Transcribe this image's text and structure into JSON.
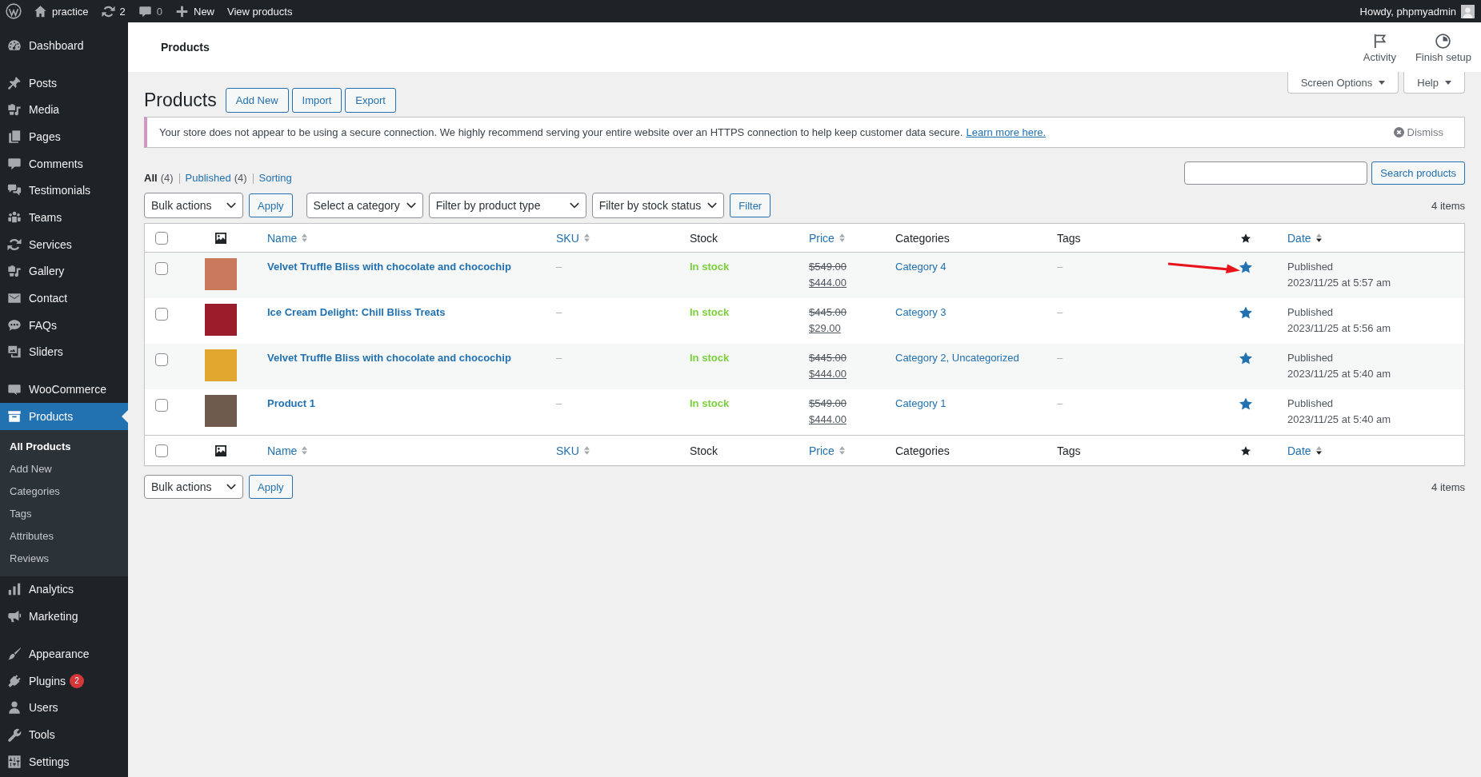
{
  "admin_bar": {
    "site": "practice",
    "updates": "2",
    "comments": "0",
    "new": "New",
    "view": "View products",
    "greeting": "Howdy, phpmyadmin"
  },
  "sidebar": {
    "groups": [
      {
        "items": [
          {
            "label": "Dashboard",
            "selected": false
          }
        ]
      },
      {
        "items": [
          {
            "label": "Posts",
            "selected": false
          },
          {
            "label": "Media",
            "selected": false
          },
          {
            "label": "Pages",
            "selected": false
          },
          {
            "label": "Comments",
            "selected": false
          },
          {
            "label": "Testimonials",
            "selected": false
          },
          {
            "label": "Teams",
            "selected": false
          },
          {
            "label": "Services",
            "selected": false
          },
          {
            "label": "Gallery",
            "selected": false
          },
          {
            "label": "Contact",
            "selected": false
          },
          {
            "label": "FAQs",
            "selected": false
          },
          {
            "label": "Sliders",
            "selected": false
          }
        ]
      },
      {
        "items": [
          {
            "label": "WooCommerce",
            "selected": false
          },
          {
            "label": "Products",
            "selected": true,
            "children": [
              {
                "label": "All Products",
                "selected": true
              },
              {
                "label": "Add New",
                "selected": false
              },
              {
                "label": "Categories",
                "selected": false
              },
              {
                "label": "Tags",
                "selected": false
              },
              {
                "label": "Attributes",
                "selected": false
              },
              {
                "label": "Reviews",
                "selected": false
              }
            ]
          },
          {
            "label": "Analytics",
            "selected": false
          },
          {
            "label": "Marketing",
            "selected": false
          }
        ]
      },
      {
        "items": [
          {
            "label": "Appearance",
            "selected": false
          },
          {
            "label": "Plugins",
            "selected": false,
            "badge": "2"
          },
          {
            "label": "Users",
            "selected": false
          },
          {
            "label": "Tools",
            "selected": false
          },
          {
            "label": "Settings",
            "selected": false
          }
        ]
      }
    ]
  },
  "header": {
    "title": "Products",
    "actions": [
      {
        "label": "Activity"
      },
      {
        "label": "Finish setup"
      }
    ]
  },
  "screen_tabs": [
    {
      "label": "Screen Options"
    },
    {
      "label": "Help"
    }
  ],
  "page": {
    "title": "Products",
    "buttons": [
      "Add New",
      "Import",
      "Export"
    ]
  },
  "notice": {
    "text": "Your store does not appear to be using a secure connection. We highly recommend serving your entire website over an HTTPS connection to help keep customer data secure.",
    "link": "Learn more here.",
    "dismiss": "Dismiss"
  },
  "views": [
    {
      "label": "All",
      "count": "(4)",
      "selected": true
    },
    {
      "label": "Published",
      "count": "(4)",
      "selected": false
    },
    {
      "label": "Sorting",
      "selected": false
    }
  ],
  "search": {
    "button": "Search products"
  },
  "top_nav": {
    "groups": [
      {
        "controls": [
          {
            "kind": "select",
            "label": "Bulk actions"
          },
          {
            "kind": "button",
            "label": "Apply"
          }
        ]
      },
      {
        "controls": [
          {
            "kind": "select",
            "label": "Select a category"
          },
          {
            "kind": "select",
            "label": "Filter by product type"
          },
          {
            "kind": "select",
            "label": "Filter by stock status"
          },
          {
            "kind": "button",
            "label": "Filter"
          }
        ]
      }
    ],
    "count": "4 items"
  },
  "table": {
    "columns": [
      {
        "kind": "check",
        "checked": false
      },
      {
        "kind": "thumb"
      },
      {
        "kind": "text",
        "label": "Name",
        "sortable": true,
        "sorted": false
      },
      {
        "kind": "text",
        "label": "SKU",
        "sortable": true,
        "sorted": false
      },
      {
        "kind": "text",
        "label": "Stock",
        "sortable": false
      },
      {
        "kind": "text",
        "label": "Price",
        "sortable": true,
        "sorted": false
      },
      {
        "kind": "text",
        "label": "Categories",
        "sortable": false
      },
      {
        "kind": "text",
        "label": "Tags",
        "sortable": false
      },
      {
        "kind": "star"
      },
      {
        "kind": "text",
        "label": "Date",
        "sortable": true,
        "sorted": true
      }
    ],
    "rows": [
      {
        "checked": false,
        "color": "#c97a5c",
        "name": "Velvet Truffle Bliss with chocolate and chocochip",
        "sku": "–",
        "stock": "In stock",
        "regular_price": "$549.00",
        "sale_price": "$444.00",
        "categories": "Category 4",
        "tags": "–",
        "featured": true,
        "arrow": true,
        "status": "Published",
        "date": "2023/11/25 at 5:57 am"
      },
      {
        "checked": false,
        "color": "#9b1c2a",
        "name": "Ice Cream Delight: Chill Bliss Treats",
        "sku": "–",
        "stock": "In stock",
        "regular_price": "$445.00",
        "sale_price": "$29.00",
        "categories": "Category 3",
        "tags": "–",
        "featured": true,
        "arrow": false,
        "status": "Published",
        "date": "2023/11/25 at 5:56 am"
      },
      {
        "checked": false,
        "color": "#e2a72e",
        "name": "Velvet Truffle Bliss with chocolate and chocochip",
        "sku": "–",
        "stock": "In stock",
        "regular_price": "$445.00",
        "sale_price": "$444.00",
        "categories": "Category 2, Uncategorized",
        "tags": "–",
        "featured": true,
        "arrow": false,
        "status": "Published",
        "date": "2023/11/25 at 5:40 am"
      },
      {
        "checked": false,
        "color": "#6e5b4e",
        "name": "Product 1",
        "sku": "–",
        "stock": "In stock",
        "regular_price": "$549.00",
        "sale_price": "$444.00",
        "categories": "Category 1",
        "tags": "–",
        "featured": true,
        "arrow": false,
        "status": "Published",
        "date": "2023/11/25 at 5:40 am"
      }
    ],
    "footer_columns": [
      {
        "kind": "check",
        "checked": false
      },
      {
        "kind": "thumb"
      },
      {
        "kind": "text",
        "label": "Name",
        "sortable": true,
        "sorted": false
      },
      {
        "kind": "text",
        "label": "SKU",
        "sortable": true,
        "sorted": false
      },
      {
        "kind": "text",
        "label": "Stock",
        "sortable": false
      },
      {
        "kind": "text",
        "label": "Price",
        "sortable": true,
        "sorted": false
      },
      {
        "kind": "text",
        "label": "Categories",
        "sortable": false
      },
      {
        "kind": "text",
        "label": "Tags",
        "sortable": false
      },
      {
        "kind": "star"
      },
      {
        "kind": "text",
        "label": "Date",
        "sortable": true,
        "sorted": true
      }
    ]
  },
  "bottom_nav": {
    "groups": [
      {
        "controls": [
          {
            "kind": "select",
            "label": "Bulk actions"
          },
          {
            "kind": "button",
            "label": "Apply"
          }
        ]
      }
    ],
    "count": "4 items"
  }
}
